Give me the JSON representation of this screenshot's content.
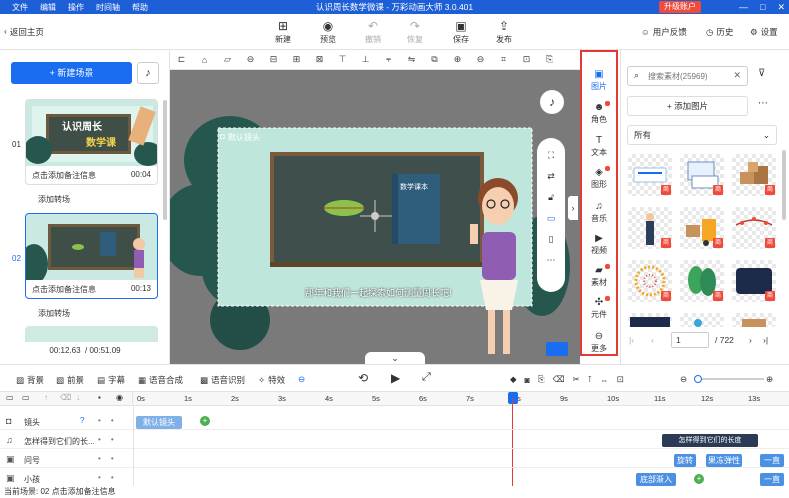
{
  "titlebar": {
    "menu": [
      "文件",
      "编辑",
      "操作",
      "时间轴",
      "帮助"
    ],
    "app_title": "认识周长数学微课 - 万彩动画大师 3.0.401",
    "upgrade": "升级账户",
    "window_controls": [
      "—",
      "□",
      "✕"
    ]
  },
  "toolbar": {
    "back": "返回主页",
    "new": "新建",
    "preview": "预览",
    "undo": "撤销",
    "redo": "恢复",
    "save": "保存",
    "publish": "发布",
    "feedback": "用户反馈",
    "history": "历史",
    "settings": "设置"
  },
  "left": {
    "new_scene": "+ 新建场景",
    "scenes": [
      {
        "num": "01",
        "caption": "点击添加备注信息",
        "duration": "00:04",
        "thumb_title": "认识周长",
        "thumb_sub": "数学课"
      },
      {
        "num": "02",
        "caption": "点击添加备注信息",
        "duration": "00:13"
      }
    ],
    "add_transition": "添加转场",
    "current_time": "00:12.63",
    "total_time": "/ 00:51.09"
  },
  "stage": {
    "camera_label": "默认镜头",
    "book_title": "数学课本",
    "subtitle": "那年和我们一起探索如何测量周长吧!"
  },
  "side": {
    "items": [
      "图片",
      "角色",
      "文本",
      "图形",
      "音乐",
      "视频",
      "素材",
      "元件",
      "更多"
    ]
  },
  "materials": {
    "search_placeholder": "搜索素材(25969)",
    "add_image": "+ 添加图片",
    "filter": "所有",
    "tag": "商",
    "page": "1",
    "total_pages": "/ 722"
  },
  "timeline": {
    "tools": [
      "背景",
      "前景",
      "字幕",
      "语音合成",
      "语音识别",
      "特效"
    ],
    "ticks": [
      "0s",
      "1s",
      "2s",
      "3s",
      "4s",
      "5s",
      "6s",
      "7s",
      "8s",
      "9s",
      "10s",
      "11s",
      "12s",
      "13s"
    ],
    "tracks": [
      {
        "name": "镜头",
        "icon": "camera-icon"
      },
      {
        "name": "怎样得到它们的长...",
        "icon": "sound-icon"
      },
      {
        "name": "问号",
        "icon": "image-icon"
      },
      {
        "name": "小孩",
        "icon": "image-icon"
      }
    ],
    "clips": {
      "camera": "默认镜头",
      "audio": "怎样得到它们的长度",
      "rotate": "旋转",
      "bounce": "果冻弹性",
      "always": "一直",
      "fade": "底部渐入",
      "always2": "一直"
    }
  },
  "status": "当前场景: 02   点击添加备注信息"
}
